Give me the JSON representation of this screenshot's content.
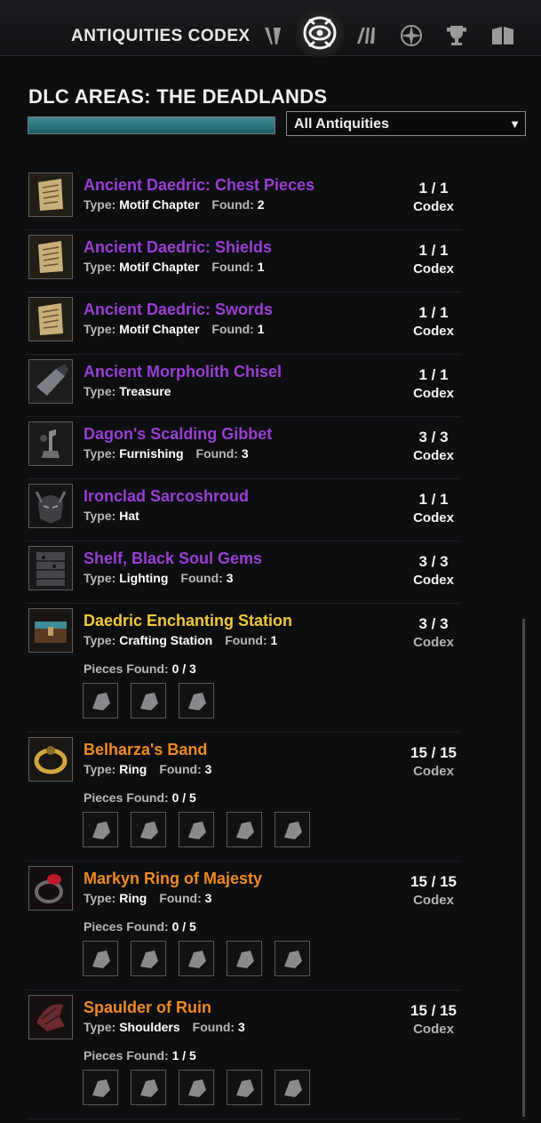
{
  "header": {
    "title": "ANTIQUITIES CODEX",
    "nav_icons": [
      "scrying-icon",
      "codex-icon",
      "journal-icon",
      "compass-icon",
      "trophy-icon",
      "book-icon"
    ]
  },
  "section": {
    "title": "DLC AREAS: THE DEADLANDS",
    "progress_fraction": 1.0,
    "filter_selected": "All Antiquities",
    "filter_arrow": "▼"
  },
  "colors": {
    "purple_name": "#9b3ed6",
    "gold_name": "#f0c93a",
    "orange_name": "#f08a22",
    "progress": "#2f7b87"
  },
  "labels": {
    "type": "Type:",
    "found": "Found:",
    "pieces_found": "Pieces Found:"
  },
  "entries": [
    {
      "name": "Ancient Daedric: Chest Pieces",
      "quality": "purple",
      "type": "Motif Chapter",
      "found": "2",
      "count": "1 / 1",
      "codex": "Codex",
      "icon": "scroll-icon"
    },
    {
      "name": "Ancient Daedric: Shields",
      "quality": "purple",
      "type": "Motif Chapter",
      "found": "1",
      "count": "1 / 1",
      "codex": "Codex",
      "icon": "scroll-icon"
    },
    {
      "name": "Ancient Daedric: Swords",
      "quality": "purple",
      "type": "Motif Chapter",
      "found": "1",
      "count": "1 / 1",
      "codex": "Codex",
      "icon": "scroll-icon"
    },
    {
      "name": "Ancient Morpholith Chisel",
      "quality": "purple",
      "type": "Treasure",
      "count": "1 / 1",
      "codex": "Codex",
      "icon": "chisel-icon"
    },
    {
      "name": "Dagon's Scalding Gibbet",
      "quality": "purple",
      "type": "Furnishing",
      "found": "3",
      "count": "3 / 3",
      "codex": "Codex",
      "icon": "gibbet-icon"
    },
    {
      "name": "Ironclad Sarcoshroud",
      "quality": "purple",
      "type": "Hat",
      "count": "1 / 1",
      "codex": "Codex",
      "icon": "helmet-icon"
    },
    {
      "name": "Shelf, Black Soul Gems",
      "quality": "purple",
      "type": "Lighting",
      "found": "3",
      "count": "3 / 3",
      "codex": "Codex",
      "icon": "shelf-icon"
    },
    {
      "name": "Daedric Enchanting Station",
      "quality": "gold",
      "type": "Crafting Station",
      "found": "1",
      "count": "3 / 3",
      "codex": "Codex",
      "icon": "chest-icon",
      "pieces_found": "0 / 3",
      "pieces": [
        "table-piece-icon",
        "spider-piece-icon",
        "stone-piece-icon"
      ]
    },
    {
      "name": "Belharza's Band",
      "quality": "orange",
      "type": "Ring",
      "found": "3",
      "count": "15 / 15",
      "codex": "Codex",
      "icon": "ring-icon",
      "pieces_found": "0 / 5",
      "pieces": [
        "ring-fragment-icon",
        "gem-fragment-icon",
        "band-fragment-icon",
        "clasp-fragment-icon",
        "shard-fragment-icon"
      ]
    },
    {
      "name": "Markyn Ring of Majesty",
      "quality": "orange",
      "type": "Ring",
      "found": "3",
      "count": "15 / 15",
      "codex": "Codex",
      "icon": "red-ring-icon",
      "pieces_found": "0 / 5",
      "pieces": [
        "band-fragment-icon",
        "torc-fragment-icon",
        "ore-fragment-icon",
        "gem-fragment-icon",
        "stone-fragment-icon"
      ]
    },
    {
      "name": "Spaulder of Ruin",
      "quality": "orange",
      "type": "Shoulders",
      "found": "3",
      "count": "15 / 15",
      "codex": "Codex",
      "icon": "spaulder-icon",
      "pieces_found": "1 / 5",
      "pieces": [
        "horn-fragment-icon",
        "spike-fragment-icon",
        "emblem-fragment-icon",
        "bell-fragment-icon",
        "plate-fragment-icon"
      ]
    }
  ]
}
